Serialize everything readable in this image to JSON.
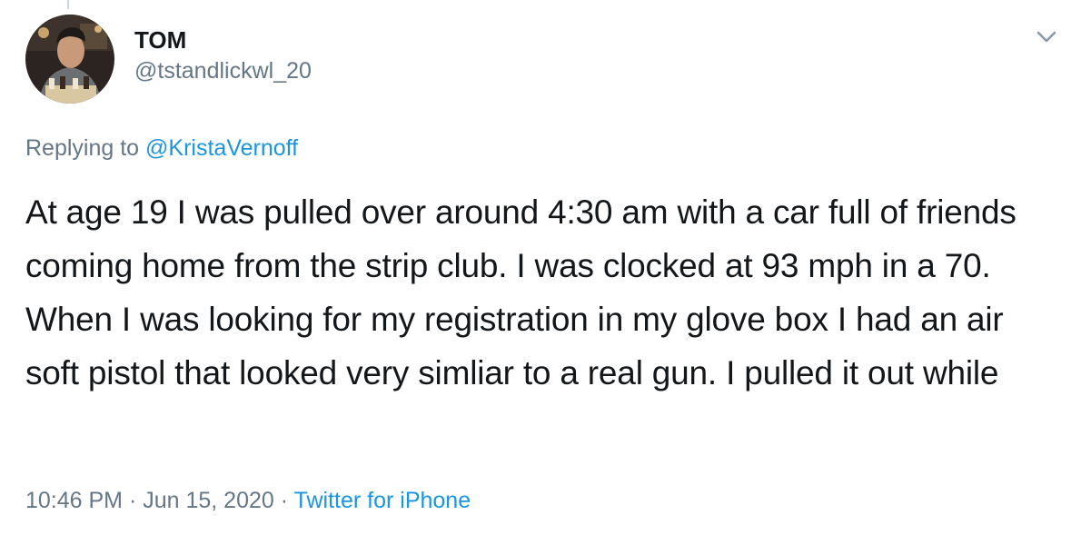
{
  "author": {
    "display_name": "TOM",
    "handle": "@tstandlickwl_20"
  },
  "reply": {
    "prefix": "Replying to ",
    "to_handle": "@KristaVernoff"
  },
  "tweet": {
    "text": "At age 19 I was pulled over around 4:30 am with a car full of friends coming home from the strip club. I was clocked at 93 mph in a 70. When I was looking for my registration in my glove box I had an air soft pistol that looked very simliar to a real gun. I pulled it out while"
  },
  "meta": {
    "time": "10:46 PM",
    "sep1": " · ",
    "date": "Jun 15, 2020",
    "sep2": " · ",
    "source": "Twitter for iPhone"
  },
  "icons": {
    "menu": "chevron-down-icon"
  },
  "colors": {
    "text": "#14171a",
    "secondary": "#657786",
    "link": "#1b95e0"
  }
}
